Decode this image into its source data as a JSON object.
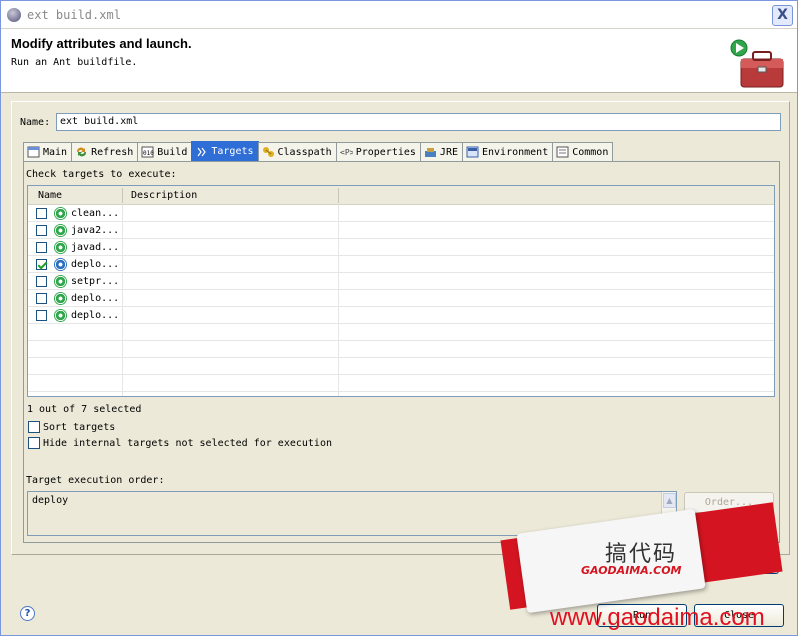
{
  "window": {
    "title": "ext build.xml",
    "close_glyph": "X"
  },
  "banner": {
    "title": "Modify attributes and launch.",
    "subtitle": "Run an Ant buildfile."
  },
  "name_field": {
    "label": "Name:",
    "value": "ext build.xml"
  },
  "tabs": [
    {
      "label": "Main",
      "icon": "main-icon"
    },
    {
      "label": "Refresh",
      "icon": "refresh-icon"
    },
    {
      "label": "Build",
      "icon": "build-icon"
    },
    {
      "label": "Targets",
      "icon": "targets-icon",
      "active": true
    },
    {
      "label": "Classpath",
      "icon": "classpath-icon"
    },
    {
      "label": "Properties",
      "icon": "properties-icon"
    },
    {
      "label": "JRE",
      "icon": "jre-icon"
    },
    {
      "label": "Environment",
      "icon": "environment-icon"
    },
    {
      "label": "Common",
      "icon": "common-icon"
    }
  ],
  "targets": {
    "label": "Check targets to execute:",
    "columns": [
      "Name",
      "Description"
    ],
    "rows": [
      {
        "name": "clean...",
        "checked": false
      },
      {
        "name": "java2...",
        "checked": false
      },
      {
        "name": "javad...",
        "checked": false
      },
      {
        "name": "deplo...",
        "checked": true
      },
      {
        "name": "setpr...",
        "checked": false
      },
      {
        "name": "deplo...",
        "checked": false
      },
      {
        "name": "deplo...",
        "checked": false
      }
    ],
    "selected_count": "1 out of 7 selected"
  },
  "options": {
    "sort": "Sort targets",
    "hide": "Hide internal targets not selected for execution"
  },
  "order": {
    "label": "Target execution order:",
    "value": "deploy",
    "button": "Order..."
  },
  "buttons": {
    "help": "?",
    "run": "Run",
    "close": "Close"
  },
  "watermark": {
    "chinese": "搞代码",
    "brand": "GAODAIMA.COM",
    "url": "www.gaodaima.com"
  },
  "colors": {
    "active_tab": "#2f6ed6",
    "watermark_red": "#d41521"
  }
}
